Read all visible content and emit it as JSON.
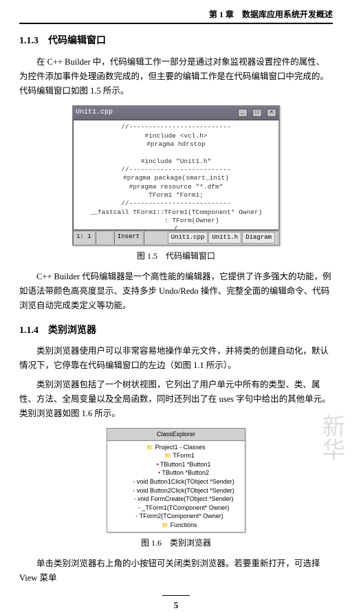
{
  "chapter_header": "第 1 章　数据库应用系统开发概述",
  "section1": {
    "number": "1.1.3",
    "title": "代码编辑窗口",
    "para1": "在 C++ Builder 中，代码编辑工作一部分是通过对象监视器设置控件的属性、为控件添加事件处理函数完成的，但主要的编辑工作是在代码编辑窗口中完成的。代码编辑窗口如图 1.5 所示。",
    "para2": "C++ Builder 代码编辑器是一个高性能的编辑器，它提供了许多强大的功能，例如语法带颜色高亮度显示、支持多步 Undo/Redo 操作、完整全面的编辑命令、代码浏览自动完成类定义等功能。"
  },
  "figure1": {
    "caption": "图 1.5　代码编辑窗口",
    "window_title": "Unit1.cpp",
    "code": "//--------------------------\n#include <vcl.h>\n#pragma hdrstop\n\n#include \"Unit1.h\"\n//--------------------------\n#pragma package(smart_init)\n#pragma resource \"*.dfm\"\nTForm1 *Form1;\n//--------------------------\n__fastcall TForm1::TForm1(TComponent* Owner)\n        : TForm(Owner)\n{",
    "status_pos": "1: 1",
    "status_mode": "Insert",
    "tabs": [
      "Unit1.cpp",
      "Unit1.h",
      "Diagram"
    ]
  },
  "section2": {
    "number": "1.1.4",
    "title": "类别浏览器",
    "para1": "类别浏览器使用户可以非常容易地操作单元文件，并将类的创建自动化，默认情况下，它停靠在代码编辑窗口的左边（如图 1.1 所示）。",
    "para2": "类别浏览器包括了一个树状视图，它列出了用户单元中所有的类型、类、属性、方法、全局变量以及全局函数，同时还列出了在 uses 字句中给出的其他单元。类别浏览器如图 1.6 所示。",
    "para3": "单击类别浏览器右上角的小按钮可关闭类别浏览器。若要重新打开，可选择 View 菜单"
  },
  "figure2": {
    "caption": "图 1.6　类别浏览器",
    "window_title": "ClassExplorer",
    "nodes": {
      "root": "Project1 - Classes",
      "n1": "TForm1",
      "n2": "TButton1 *Button1",
      "n3": "TButton *Button2",
      "n4": "void Button1Click(TObject *Sender)",
      "n5": "void Button2Click(TObject *Sender)",
      "n6": "void FormCreate(TObject *Sender)",
      "n7": "_TForm1(TComponent* Owner)",
      "n8": "TForm2(TComponent* Owner)",
      "n9": "Functions"
    }
  },
  "page_number": "5",
  "watermark": "新华"
}
